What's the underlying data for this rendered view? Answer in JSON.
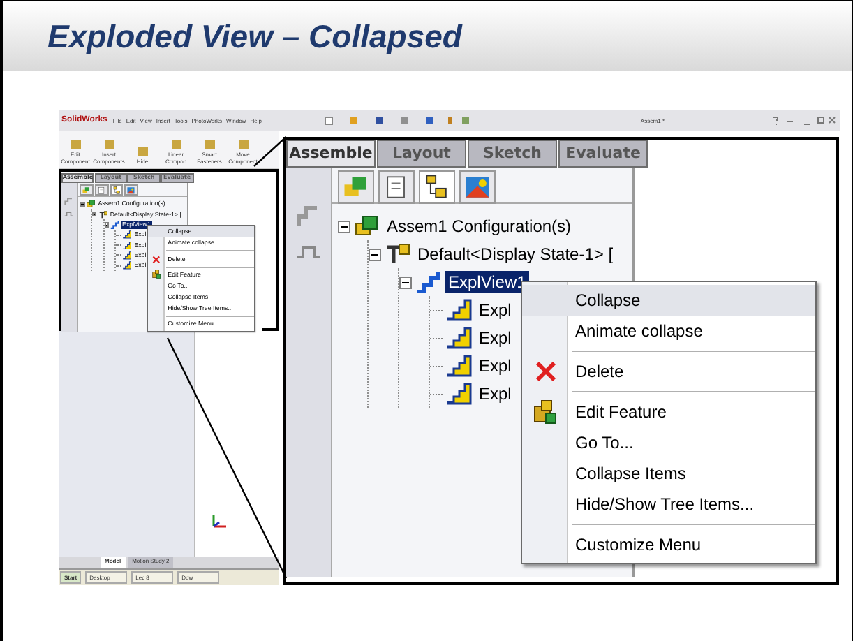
{
  "slide_title": "Exploded View – Collapsed",
  "screenshot": {
    "app_name": "SolidWorks",
    "menu": [
      "File",
      "Edit",
      "View",
      "Insert",
      "Tools",
      "PhotoWorks",
      "Window",
      "Help"
    ],
    "document_title": "Assem1 *",
    "ribbon": [
      "Edit Component",
      "Insert Components",
      "Hide",
      "Linear Compon",
      "Smart Fasteners",
      "Move Component"
    ],
    "feature_panel": {
      "tabs": [
        {
          "label": "Assemble",
          "selected": true
        },
        {
          "label": "Layout",
          "selected": false
        },
        {
          "label": "Sketch",
          "selected": false
        },
        {
          "label": "Evaluate",
          "selected": false
        }
      ],
      "tree": [
        {
          "label": "Assem1 Configuration(s)",
          "kind": "assembly",
          "expanded": true,
          "selected": false,
          "children": [
            {
              "label": "Default<Display State-1> [",
              "kind": "configuration",
              "expanded": true,
              "selected": false,
              "children": [
                {
                  "label": "ExplView1",
                  "kind": "explode",
                  "expanded": true,
                  "selected": true,
                  "children": [
                    {
                      "label": "Expl",
                      "kind": "step",
                      "selected": false
                    },
                    {
                      "label": "Expl",
                      "kind": "step",
                      "selected": false
                    },
                    {
                      "label": "Expl",
                      "kind": "step",
                      "selected": false
                    },
                    {
                      "label": "Expl",
                      "kind": "step",
                      "selected": false
                    }
                  ]
                }
              ]
            }
          ]
        }
      ],
      "context_menu": [
        [
          {
            "label": "Collapse",
            "kind": "plain",
            "selected": true
          },
          {
            "label": "Animate collapse",
            "kind": "plain",
            "selected": false
          }
        ],
        [
          {
            "label": "Delete",
            "kind": "delete",
            "selected": false
          }
        ],
        [
          {
            "label": "Edit Feature",
            "kind": "edit",
            "selected": false
          },
          {
            "label": "Go To...",
            "kind": "plain",
            "selected": false
          },
          {
            "label": "Collapse Items",
            "kind": "plain",
            "selected": false
          },
          {
            "label": "Hide/Show Tree Items...",
            "kind": "plain",
            "selected": false
          }
        ],
        [
          {
            "label": "Customize Menu",
            "kind": "plain",
            "selected": false
          }
        ]
      ]
    },
    "bottom_tabs": [
      {
        "label": "Model",
        "selected": true
      },
      {
        "label": "Motion Study 2",
        "selected": false
      }
    ],
    "taskbar": [
      "Start",
      "Desktop",
      "Lec 8",
      "Dow"
    ]
  },
  "detail": {
    "tabs": [
      {
        "label": "Assemble",
        "selected": true
      },
      {
        "label": "Layout",
        "selected": false
      },
      {
        "label": "Sketch",
        "selected": false
      },
      {
        "label": "Evaluate",
        "selected": false
      }
    ],
    "tree": [
      {
        "label": "Assem1 Configuration(s)",
        "kind": "assembly",
        "expanded": true,
        "selected": false,
        "children": [
          {
            "label": "Default<Display State-1> [",
            "kind": "configuration",
            "expanded": true,
            "selected": false,
            "children": [
              {
                "label": "ExplView1",
                "kind": "explode",
                "expanded": true,
                "selected": true,
                "children": [
                  {
                    "label": "Expl",
                    "kind": "step",
                    "selected": false
                  },
                  {
                    "label": "Expl",
                    "kind": "step",
                    "selected": false
                  },
                  {
                    "label": "Expl",
                    "kind": "step",
                    "selected": false
                  },
                  {
                    "label": "Expl",
                    "kind": "step",
                    "selected": false
                  }
                ]
              }
            ]
          }
        ]
      }
    ],
    "context_menu": [
      [
        {
          "label": "Collapse",
          "kind": "plain",
          "selected": true
        },
        {
          "label": "Animate collapse",
          "kind": "plain",
          "selected": false
        }
      ],
      [
        {
          "label": "Delete",
          "kind": "delete",
          "selected": false
        }
      ],
      [
        {
          "label": "Edit Feature",
          "kind": "edit",
          "selected": false
        },
        {
          "label": "Go To...",
          "kind": "plain",
          "selected": false
        },
        {
          "label": "Collapse Items",
          "kind": "plain",
          "selected": false
        },
        {
          "label": "Hide/Show Tree Items...",
          "kind": "plain",
          "selected": false
        }
      ],
      [
        {
          "label": "Customize Menu",
          "kind": "plain",
          "selected": false
        }
      ]
    ]
  }
}
